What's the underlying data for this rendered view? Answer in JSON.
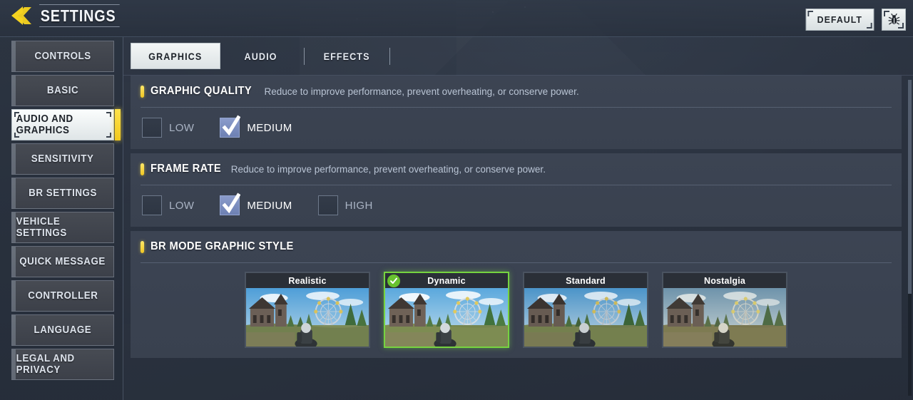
{
  "header": {
    "title": "SETTINGS",
    "back_icon": "back-arrow-icon",
    "default_button": "DEFAULT",
    "bug_button_icon": "bug-icon"
  },
  "sidebar": {
    "items": [
      {
        "label": "CONTROLS",
        "active": false
      },
      {
        "label": "BASIC",
        "active": false
      },
      {
        "label": "AUDIO AND GRAPHICS",
        "active": true
      },
      {
        "label": "SENSITIVITY",
        "active": false
      },
      {
        "label": "BR SETTINGS",
        "active": false
      },
      {
        "label": "VEHICLE SETTINGS",
        "active": false
      },
      {
        "label": "QUICK MESSAGE",
        "active": false
      },
      {
        "label": "CONTROLLER",
        "active": false
      },
      {
        "label": "LANGUAGE",
        "active": false
      },
      {
        "label": "LEGAL AND PRIVACY",
        "active": false
      }
    ]
  },
  "tabs": [
    {
      "label": "GRAPHICS",
      "active": true
    },
    {
      "label": "AUDIO",
      "active": false
    },
    {
      "label": "EFFECTS",
      "active": false
    }
  ],
  "sections": {
    "graphic_quality": {
      "title": "GRAPHIC QUALITY",
      "description": "Reduce to improve performance, prevent overheating, or conserve power.",
      "options": [
        {
          "label": "LOW",
          "checked": false
        },
        {
          "label": "MEDIUM",
          "checked": true
        }
      ]
    },
    "frame_rate": {
      "title": "FRAME RATE",
      "description": "Reduce to improve performance, prevent overheating, or conserve power.",
      "options": [
        {
          "label": "LOW",
          "checked": false
        },
        {
          "label": "MEDIUM",
          "checked": true
        },
        {
          "label": "HIGH",
          "checked": false
        }
      ]
    },
    "br_mode_graphic_style": {
      "title": "BR MODE GRAPHIC STYLE",
      "description": "",
      "styles": [
        {
          "label": "Realistic",
          "selected": false
        },
        {
          "label": "Dynamic",
          "selected": true
        },
        {
          "label": "Standard",
          "selected": false
        },
        {
          "label": "Nostalgia",
          "selected": false
        }
      ]
    }
  },
  "colors": {
    "accent_yellow": "#ffe24a",
    "selected_green": "#76d340",
    "checkbox_blue": "#7b8cc0",
    "panel_bg": "#3c4453",
    "app_bg": "#2c3442"
  }
}
